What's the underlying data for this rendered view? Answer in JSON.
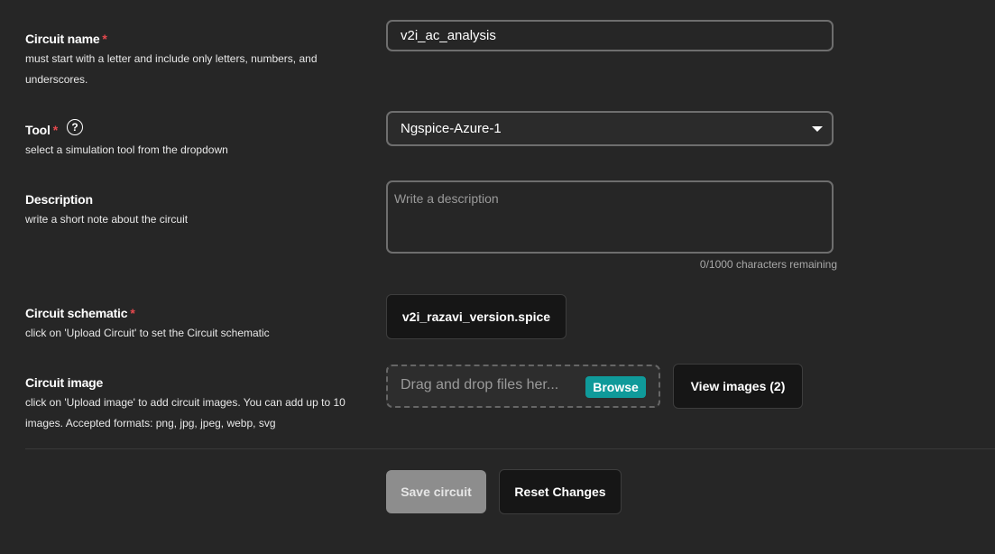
{
  "circuit_name": {
    "label": "Circuit name",
    "required_mark": "*",
    "hint_line1": "must start with a letter and include only letters, numbers, and",
    "hint_line2": "underscores.",
    "value": "v2i_ac_analysis"
  },
  "tool": {
    "label": "Tool",
    "required_mark": "*",
    "help_icon": "?",
    "hint": "select a simulation tool from the dropdown",
    "selected": "Ngspice-Azure-1"
  },
  "description": {
    "label": "Description",
    "hint": "write a short note about the circuit",
    "placeholder": "Write a description",
    "counter": "0/1000 characters remaining"
  },
  "schematic": {
    "label": "Circuit schematic",
    "required_mark": "*",
    "hint": "click on 'Upload Circuit' to set the Circuit schematic",
    "file_button": "v2i_razavi_version.spice"
  },
  "image": {
    "label": "Circuit image",
    "hint_line1": "click on 'Upload image' to add circuit images. You can add up to 10",
    "hint_line2": "images. Accepted formats: png, jpg, jpeg, webp, svg",
    "dropzone_text": "Drag and drop files her...",
    "browse_label": "Browse",
    "view_button": "View images (2)"
  },
  "actions": {
    "save": "Save circuit",
    "reset": "Reset Changes"
  },
  "colors": {
    "background": "#262626",
    "required": "#e5484d",
    "browse": "#0f9a9a",
    "disabled_button": "#8d8d8d"
  }
}
